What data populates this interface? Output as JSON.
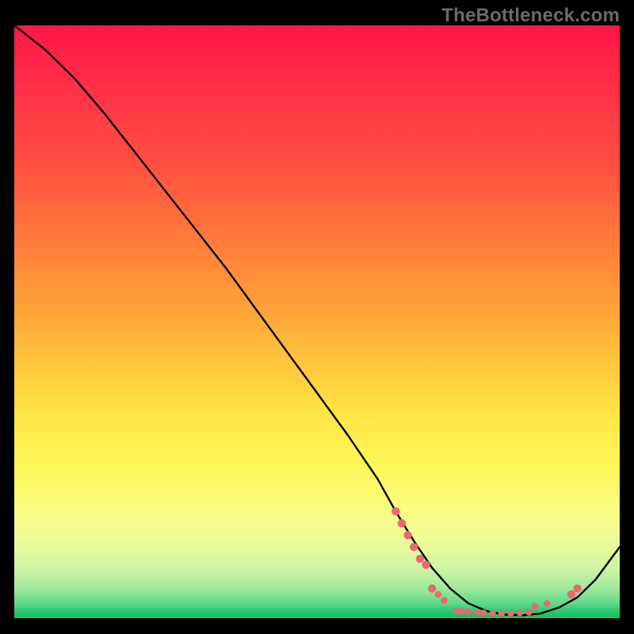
{
  "watermark": "TheBottleneck.com",
  "chart_data": {
    "type": "line",
    "title": "",
    "xlabel": "",
    "ylabel": "",
    "xlim": [
      0,
      100
    ],
    "ylim": [
      0,
      100
    ],
    "series": [
      {
        "name": "bottleneck-curve",
        "x": [
          0,
          5,
          10,
          15,
          20,
          25,
          30,
          35,
          40,
          45,
          50,
          55,
          60,
          63,
          66,
          69,
          72,
          75,
          78,
          81,
          84,
          87,
          90,
          93,
          96,
          100
        ],
        "y": [
          100,
          96,
          91,
          85,
          78.5,
          72,
          65.5,
          59,
          52,
          45,
          38,
          31,
          23.5,
          18,
          13,
          8.5,
          5,
          2.5,
          1.2,
          0.6,
          0.5,
          0.8,
          1.8,
          3.5,
          6.5,
          12
        ],
        "points": [
          {
            "x": 63,
            "y": 18
          },
          {
            "x": 64,
            "y": 16
          },
          {
            "x": 65,
            "y": 14
          },
          {
            "x": 66,
            "y": 12
          },
          {
            "x": 67,
            "y": 10
          },
          {
            "x": 68,
            "y": 9
          },
          {
            "x": 69,
            "y": 5
          },
          {
            "x": 70,
            "y": 4
          },
          {
            "x": 71,
            "y": 3
          },
          {
            "x": 73,
            "y": 1.3
          },
          {
            "x": 74,
            "y": 1.2
          },
          {
            "x": 75,
            "y": 1.1
          },
          {
            "x": 76.5,
            "y": 1
          },
          {
            "x": 77.5,
            "y": 0.9
          },
          {
            "x": 79,
            "y": 0.8
          },
          {
            "x": 80.5,
            "y": 0.8
          },
          {
            "x": 82,
            "y": 0.8
          },
          {
            "x": 83.5,
            "y": 0.9
          },
          {
            "x": 85,
            "y": 1
          },
          {
            "x": 86,
            "y": 2
          },
          {
            "x": 88,
            "y": 2.5
          },
          {
            "x": 92,
            "y": 4
          },
          {
            "x": 93,
            "y": 5
          }
        ]
      }
    ],
    "background_bands": [
      {
        "label": "red_top",
        "color": "#ff1646"
      },
      {
        "label": "orange_mid",
        "color": "#ffa338"
      },
      {
        "label": "yellow_low",
        "color": "#ffe646"
      },
      {
        "label": "green_bottom",
        "color": "#24c86f"
      }
    ]
  }
}
